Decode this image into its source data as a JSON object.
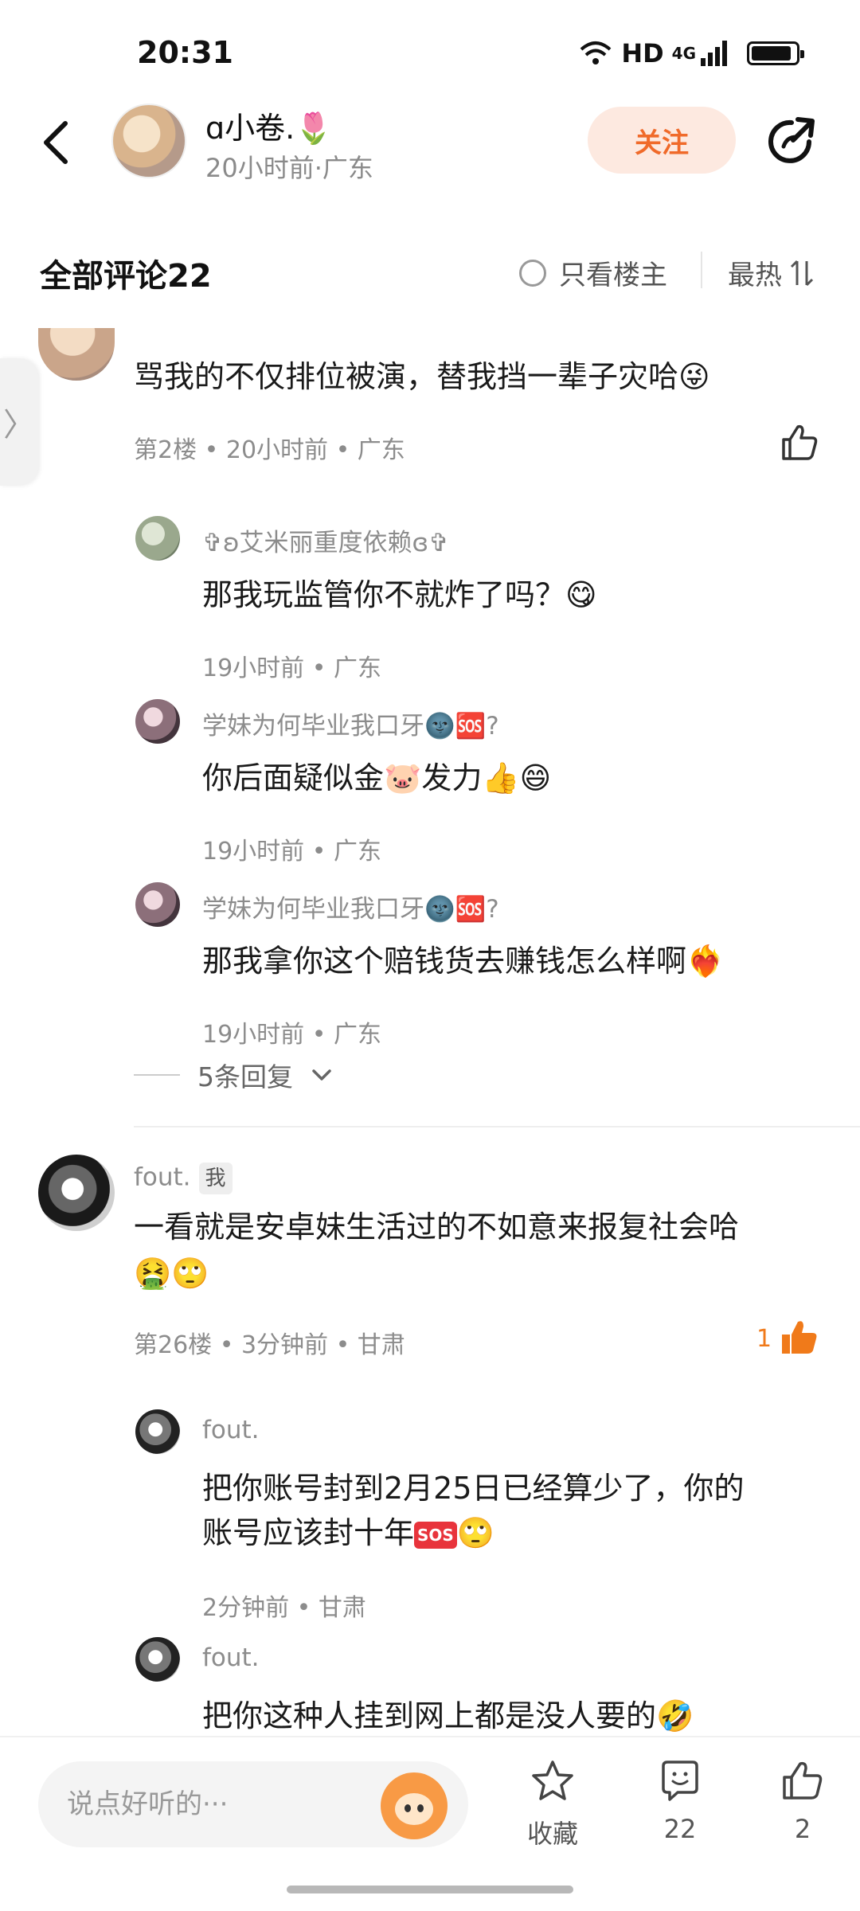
{
  "status_bar": {
    "time": "20:31",
    "network": "HD",
    "network_gen": "4G",
    "battery_level": 0.9
  },
  "header": {
    "author_name": "ɑ小卷.🌷",
    "author_meta": "20小时前·广东",
    "follow_label": "关注",
    "icons": [
      "back-icon",
      "share-icon"
    ]
  },
  "comments_bar": {
    "title": "全部评论22",
    "op_only_label": "只看楼主",
    "sort_label": "最热",
    "sort_icon": "sort-icon"
  },
  "side_tab": {
    "glyph": "〉"
  },
  "comment_2": {
    "text": "骂我的不仅排位被演，替我挡一辈子灾哈😜",
    "meta": "第2楼 • 20小时前 • 广东",
    "replies": [
      {
        "name": "✞ʚ艾米丽重度依赖ɞ✞",
        "text": "那我玩监管你不就炸了吗？😋",
        "meta": "19小时前 • 广东"
      },
      {
        "name": "学妹为何毕业我口牙🌚🆘?",
        "text": "你后面疑似金🐷发力👍😄",
        "meta": "19小时前 • 广东"
      },
      {
        "name": "学妹为何毕业我口牙🌚🆘?",
        "text": "那我拿你这个赔钱货去赚钱怎么样啊❤️‍🔥",
        "meta": "19小时前 • 广东"
      }
    ],
    "more_replies": "5条回复"
  },
  "comment_26": {
    "name": "fout.",
    "tag": "我",
    "text_line1": "一看就是安卓妹生活过的不如意来报复社会哈",
    "text_line2": "🤮🙄",
    "meta": "第26楼 • 3分钟前 • 甘肃",
    "like_count": "1",
    "replies": [
      {
        "name": "fout.",
        "text_line1": "把你账号封到2月25日已经算少了，你的",
        "text_line2": "账号应该封十年",
        "text_line2_tail": "🙄",
        "sos": "SOS",
        "meta": "2分钟前 • 甘肃"
      },
      {
        "name": "fout.",
        "text": "把你这种人挂到网上都是没人要的🤣"
      }
    ]
  },
  "bottom_bar": {
    "input_placeholder": "说点好听的···",
    "favorite_label": "收藏",
    "comment_count": "22",
    "like_count": "2"
  },
  "colors": {
    "accent": "#f06a2a",
    "follow_bg": "#fde9e0",
    "like_active": "#f07a1a",
    "meta_text": "#8c8c8c"
  }
}
